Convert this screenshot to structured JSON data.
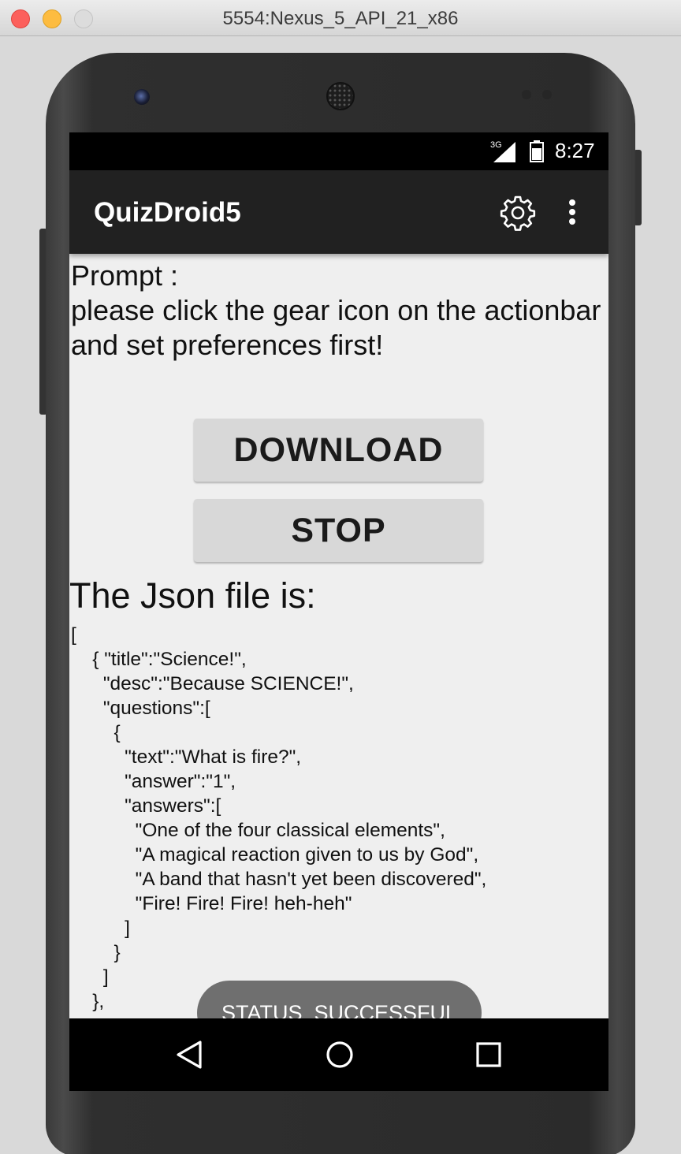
{
  "window": {
    "title": "5554:Nexus_5_API_21_x86"
  },
  "status_bar": {
    "network": "3G",
    "time": "8:27"
  },
  "action_bar": {
    "title": "QuizDroid5",
    "settings_icon": "gear-icon",
    "overflow_icon": "more-vert-icon"
  },
  "prompt": {
    "text": "Prompt :\nplease click the gear icon on the actionbar and set preferences first!"
  },
  "buttons": {
    "download_label": "DOWNLOAD",
    "stop_label": "STOP"
  },
  "json_section": {
    "heading": "The Json file is:",
    "content": "[\n    { \"title\":\"Science!\",\n      \"desc\":\"Because SCIENCE!\",\n      \"questions\":[\n        {\n          \"text\":\"What is fire?\",\n          \"answer\":\"1\",\n          \"answers\":[\n            \"One of the four classical elements\",\n            \"A magical reaction given to us by God\",\n            \"A band that hasn't yet been discovered\",\n            \"Fire! Fire! Fire! heh-heh\"\n          ]\n        }\n      ]\n    },"
  },
  "toast": {
    "text": "STATUS_SUCCESSFUL"
  },
  "nav_bar": {
    "back_icon": "back-icon",
    "home_icon": "home-icon",
    "recents_icon": "recents-icon"
  }
}
